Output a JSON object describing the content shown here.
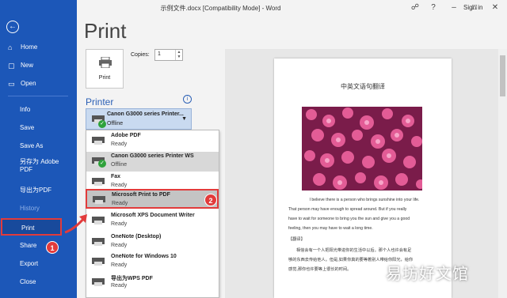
{
  "window": {
    "title": "示例文件.docx [Compatibility Mode] - Word",
    "sign_in": "Sign in",
    "icons": [
      "share-icon",
      "help-icon",
      "minimize-icon",
      "restore-icon",
      "close-icon"
    ]
  },
  "sidebar": {
    "items": [
      {
        "label": "Home",
        "icon": "home-icon"
      },
      {
        "label": "New",
        "icon": "new-doc-icon"
      },
      {
        "label": "Open",
        "icon": "folder-icon"
      },
      {
        "label": "Info"
      },
      {
        "label": "Save"
      },
      {
        "label": "Save As"
      },
      {
        "label": "另存为 Adobe PDF"
      },
      {
        "label": "导出为PDF"
      },
      {
        "label": "History"
      },
      {
        "label": "Print"
      },
      {
        "label": "Share"
      },
      {
        "label": "Export"
      },
      {
        "label": "Close"
      }
    ],
    "badge": "1"
  },
  "print": {
    "heading": "Print",
    "button_label": "Print",
    "copies_label": "Copies:",
    "copies_value": "1",
    "printer_heading": "Printer",
    "selected": {
      "name": "Canon G3000 series Printer...",
      "status": "Offline"
    },
    "badge": "2",
    "options": [
      {
        "name": "Adobe PDF",
        "status": "Ready"
      },
      {
        "name": "Canon G3000 series Printer WS",
        "status": "Offline"
      },
      {
        "name": "Fax",
        "status": "Ready"
      },
      {
        "name": "Microsoft Print to PDF",
        "status": "Ready"
      },
      {
        "name": "Microsoft XPS Document Writer",
        "status": "Ready"
      },
      {
        "name": "OneNote (Desktop)",
        "status": "Ready"
      },
      {
        "name": "OneNote for Windows 10",
        "status": "Ready"
      },
      {
        "name": "导出为WPS PDF",
        "status": "Ready"
      }
    ]
  },
  "preview": {
    "title": "中英文语句翻译",
    "lines": [
      "I believe there is a person who brings sunshine into your life.",
      "That person may have enough to spread around. But if you really",
      "have to wait for someone to bring you the sun and give you a good",
      "feeling, then you may have to wait a long time.",
      "【翻译】",
      "相信会有一个人把阳光带进你的生活中以后。那个人也许会有足",
      "够的东西去传给他人。但是,如果你真的要等着别人带给你阳光，给你",
      "感觉,那你也许要等上很长的时间。"
    ]
  },
  "watermark": "易坊好文馆"
}
